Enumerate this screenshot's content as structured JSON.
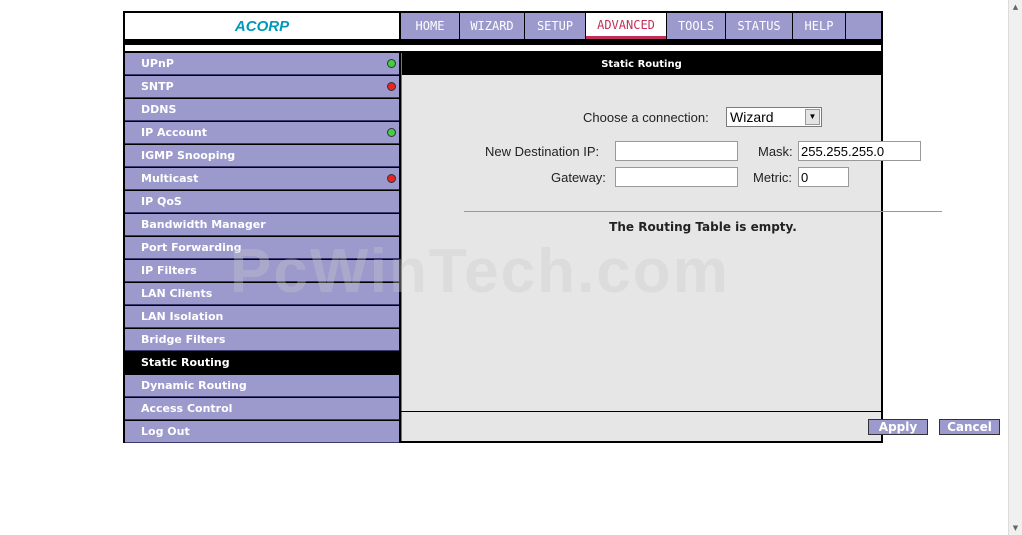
{
  "brand": {
    "logo_text": "ACORP"
  },
  "nav": {
    "tabs": [
      {
        "label": "HOME",
        "active": false
      },
      {
        "label": "WIZARD",
        "active": false
      },
      {
        "label": "SETUP",
        "active": false
      },
      {
        "label": "ADVANCED",
        "active": true
      },
      {
        "label": "TOOLS",
        "active": false
      },
      {
        "label": "STATUS",
        "active": false
      },
      {
        "label": "HELP",
        "active": false
      }
    ]
  },
  "sidebar": {
    "items": [
      {
        "label": "UPnP",
        "status": "green"
      },
      {
        "label": "SNTP",
        "status": "red"
      },
      {
        "label": "DDNS",
        "status": ""
      },
      {
        "label": "IP Account",
        "status": "green"
      },
      {
        "label": "IGMP Snooping",
        "status": ""
      },
      {
        "label": "Multicast",
        "status": "red"
      },
      {
        "label": "IP QoS",
        "status": ""
      },
      {
        "label": "Bandwidth Manager",
        "status": ""
      },
      {
        "label": "Port Forwarding",
        "status": ""
      },
      {
        "label": "IP Filters",
        "status": ""
      },
      {
        "label": "LAN Clients",
        "status": ""
      },
      {
        "label": "LAN Isolation",
        "status": ""
      },
      {
        "label": "Bridge Filters",
        "status": ""
      },
      {
        "label": "Static Routing",
        "status": "",
        "active": true
      },
      {
        "label": "Dynamic Routing",
        "status": ""
      },
      {
        "label": "Access Control",
        "status": ""
      },
      {
        "label": "Log Out",
        "status": ""
      }
    ]
  },
  "content": {
    "title": "Static Routing",
    "connection_label": "Choose a connection:",
    "connection_value": "Wizard",
    "dest_ip_label": "New Destination IP:",
    "dest_ip_value": "",
    "mask_label": "Mask:",
    "mask_value": "255.255.255.0",
    "gateway_label": "Gateway:",
    "gateway_value": "",
    "metric_label": "Metric:",
    "metric_value": "0",
    "empty_message": "The Routing Table is empty."
  },
  "footer": {
    "apply_label": "Apply",
    "cancel_label": "Cancel"
  },
  "watermark": "PcWinTech.com",
  "colors": {
    "accent": "#9c99cc",
    "active_tab_text": "#c0305a",
    "status_green": "#44cc44",
    "status_red": "#ee2222"
  }
}
